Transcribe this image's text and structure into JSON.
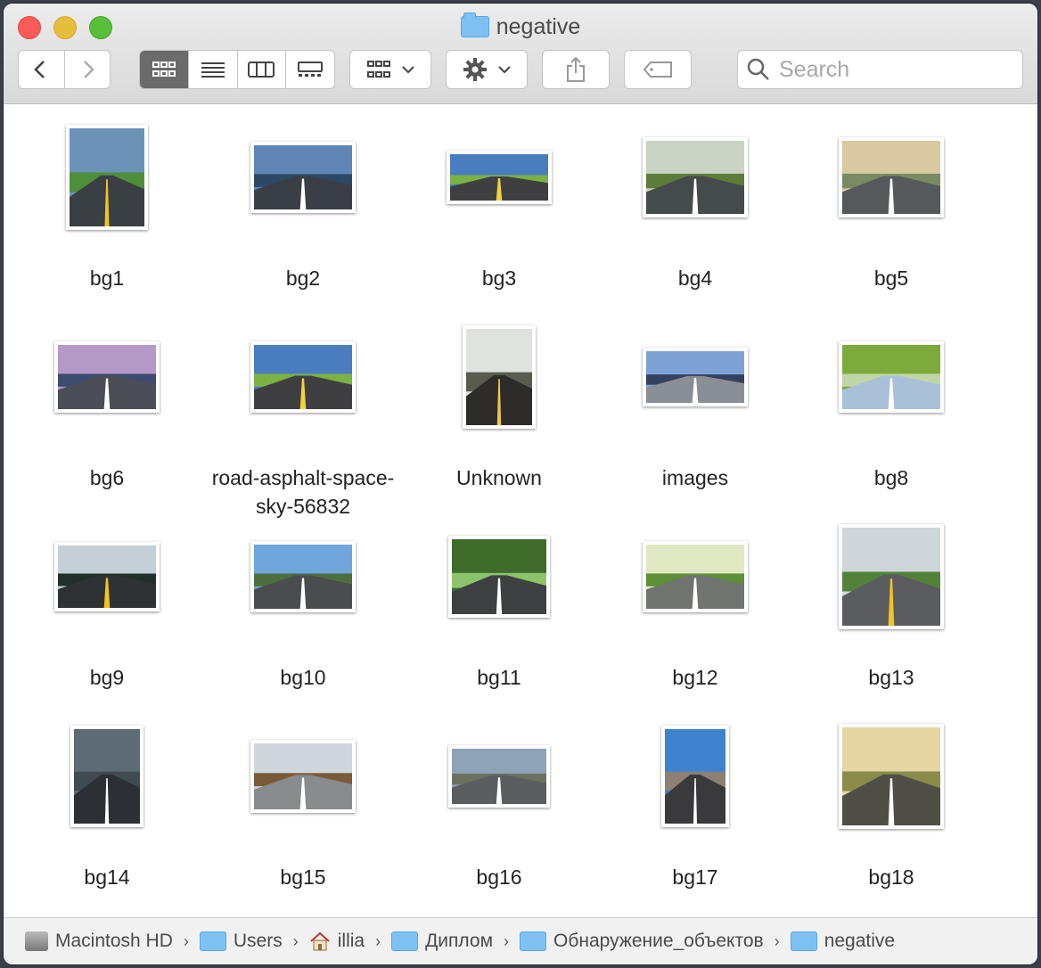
{
  "window": {
    "title": "negative"
  },
  "toolbar": {
    "back_icon": "chevron-left-icon",
    "forward_icon": "chevron-right-icon",
    "views": [
      "icon-view",
      "list-view",
      "column-view",
      "gallery-view"
    ],
    "active_view": "icon-view",
    "search_placeholder": "Search"
  },
  "items": [
    {
      "label": "bg1",
      "scene": "forest"
    },
    {
      "label": "bg2",
      "scene": "blue-road"
    },
    {
      "label": "bg3",
      "scene": "sky-road"
    },
    {
      "label": "bg4",
      "scene": "hills"
    },
    {
      "label": "bg5",
      "scene": "sunset-road"
    },
    {
      "label": "bg6",
      "scene": "city-road"
    },
    {
      "label": "road-asphalt-space-sky-56832",
      "scene": "sky-road"
    },
    {
      "label": "Unknown",
      "scene": "curve"
    },
    {
      "label": "images",
      "scene": "crossing"
    },
    {
      "label": "bg8",
      "scene": "park"
    },
    {
      "label": "bg9",
      "scene": "dark-forest"
    },
    {
      "label": "bg10",
      "scene": "trees-road"
    },
    {
      "label": "bg11",
      "scene": "tree-tunnel"
    },
    {
      "label": "bg12",
      "scene": "green-road"
    },
    {
      "label": "bg13",
      "scene": "mountain-curve"
    },
    {
      "label": "bg14",
      "scene": "storm"
    },
    {
      "label": "bg15",
      "scene": "autumn"
    },
    {
      "label": "bg16",
      "scene": "plain"
    },
    {
      "label": "bg17",
      "scene": "volcano"
    },
    {
      "label": "bg18",
      "scene": "golden"
    }
  ],
  "pathbar": [
    {
      "label": "Macintosh HD",
      "icon": "disk-icon"
    },
    {
      "label": "Users",
      "icon": "users-folder-icon"
    },
    {
      "label": "illia",
      "icon": "home-icon"
    },
    {
      "label": "Диплом",
      "icon": "folder-icon"
    },
    {
      "label": "Обнаружение_объектов",
      "icon": "folder-icon"
    },
    {
      "label": "negative",
      "icon": "folder-icon"
    }
  ]
}
